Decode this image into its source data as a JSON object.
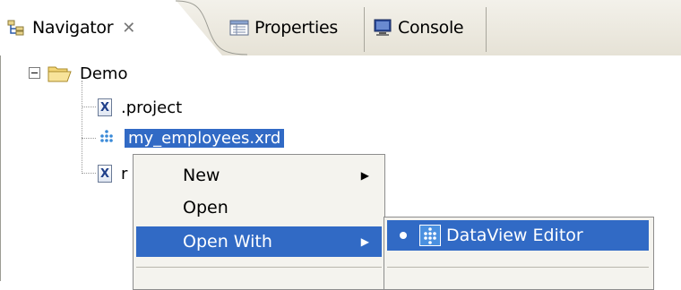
{
  "tabs": [
    {
      "label": "Navigator",
      "icon": "navigator-icon",
      "active": true,
      "closable": true
    },
    {
      "label": "Properties",
      "icon": "properties-icon",
      "active": false
    },
    {
      "label": "Console",
      "icon": "console-icon",
      "active": false
    }
  ],
  "tree": {
    "root": {
      "label": "Demo",
      "icon": "folder-open-icon",
      "expanded": true
    },
    "children": [
      {
        "label": ".project",
        "icon": "xml-file-icon"
      },
      {
        "label": "my_employees.xrd",
        "icon": "dataview-file-icon",
        "selected": true
      },
      {
        "label": "r",
        "icon": "xml-file-icon"
      }
    ]
  },
  "context_menu": {
    "items": [
      {
        "label": "New",
        "has_submenu": true
      },
      {
        "label": "Open",
        "has_submenu": false
      },
      {
        "label": "Open With",
        "has_submenu": true,
        "highlighted": true
      }
    ]
  },
  "submenu": {
    "items": [
      {
        "label": "DataView Editor",
        "icon": "dataview-editor-icon",
        "checked": true,
        "highlighted": true
      }
    ]
  },
  "colors": {
    "selection": "#316ac5",
    "menu_bg": "#f4f3ee",
    "tabbar_bg": "#ece9d8"
  }
}
